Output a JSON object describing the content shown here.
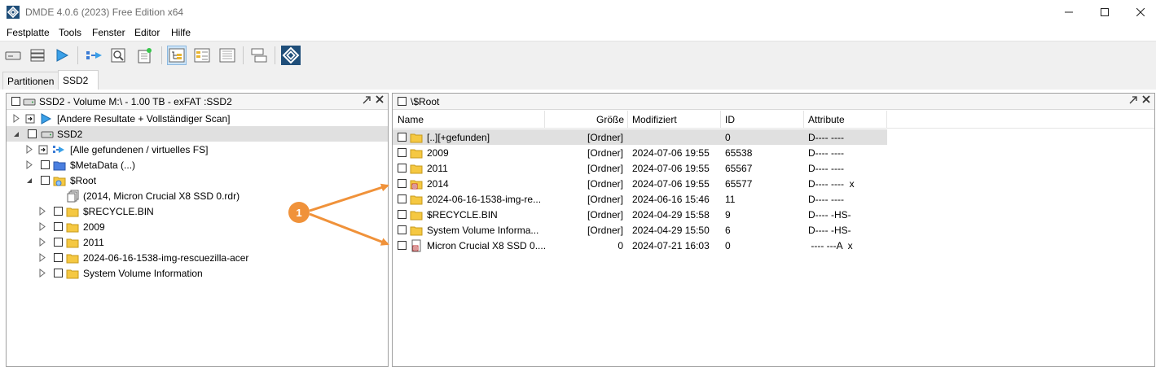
{
  "window": {
    "title": "DMDE 4.0.6 (2023) Free Edition x64",
    "min_icon": "minimize-icon",
    "max_icon": "maximize-icon",
    "close_icon": "close-icon"
  },
  "menu": [
    "Festplatte",
    "Tools",
    "Fenster",
    "Editor",
    "Hilfe"
  ],
  "tabs": [
    {
      "label": "Partitionen",
      "active": false
    },
    {
      "label": "SSD2",
      "active": true
    }
  ],
  "left_panel": {
    "title": "SSD2 - Volume M:\\ - 1.00 TB - exFAT :SSD2",
    "tree": [
      {
        "label": "[Andere Resultate + Vollständiger Scan]"
      },
      {
        "label": "SSD2"
      },
      {
        "label": "[Alle gefundenen / virtuelles FS]"
      },
      {
        "label": "$MetaData (...)"
      },
      {
        "label": "$Root"
      },
      {
        "label": "(2014, Micron Crucial X8 SSD 0.rdr)"
      },
      {
        "label": "$RECYCLE.BIN"
      },
      {
        "label": "2009"
      },
      {
        "label": "2011"
      },
      {
        "label": "2024-06-16-1538-img-rescuezilla-acer"
      },
      {
        "label": "System Volume Information"
      }
    ]
  },
  "right_panel": {
    "title": "\\$Root",
    "columns": [
      "Name",
      "Größe",
      "Modifiziert",
      "ID",
      "Attribute"
    ],
    "rows": [
      {
        "name": "[..][+gefunden]",
        "size": "[Ordner]",
        "modified": "",
        "id": "0",
        "attr": "D---- ----"
      },
      {
        "name": "2009",
        "size": "[Ordner]",
        "modified": "2024-07-06 19:55",
        "id": "65538",
        "attr": "D---- ----"
      },
      {
        "name": "2011",
        "size": "[Ordner]",
        "modified": "2024-07-06 19:55",
        "id": "65567",
        "attr": "D---- ----"
      },
      {
        "name": "2014",
        "size": "[Ordner]",
        "modified": "2024-07-06 19:55",
        "id": "65577",
        "attr": "D---- ----  x"
      },
      {
        "name": "2024-06-16-1538-img-re...",
        "size": "[Ordner]",
        "modified": "2024-06-16 15:46",
        "id": "11",
        "attr": "D---- ----"
      },
      {
        "name": "$RECYCLE.BIN",
        "size": "[Ordner]",
        "modified": "2024-04-29 15:58",
        "id": "9",
        "attr": "D---- -HS-"
      },
      {
        "name": "System Volume Informa...",
        "size": "[Ordner]",
        "modified": "2024-04-29 15:50",
        "id": "6",
        "attr": "D---- -HS-"
      },
      {
        "name": "Micron Crucial X8 SSD 0....",
        "size": "0",
        "modified": "2024-07-21 16:03",
        "id": "0",
        "attr": " ---- ---A  x"
      }
    ]
  },
  "annotation": {
    "label": "1",
    "color": "#f0923a"
  }
}
